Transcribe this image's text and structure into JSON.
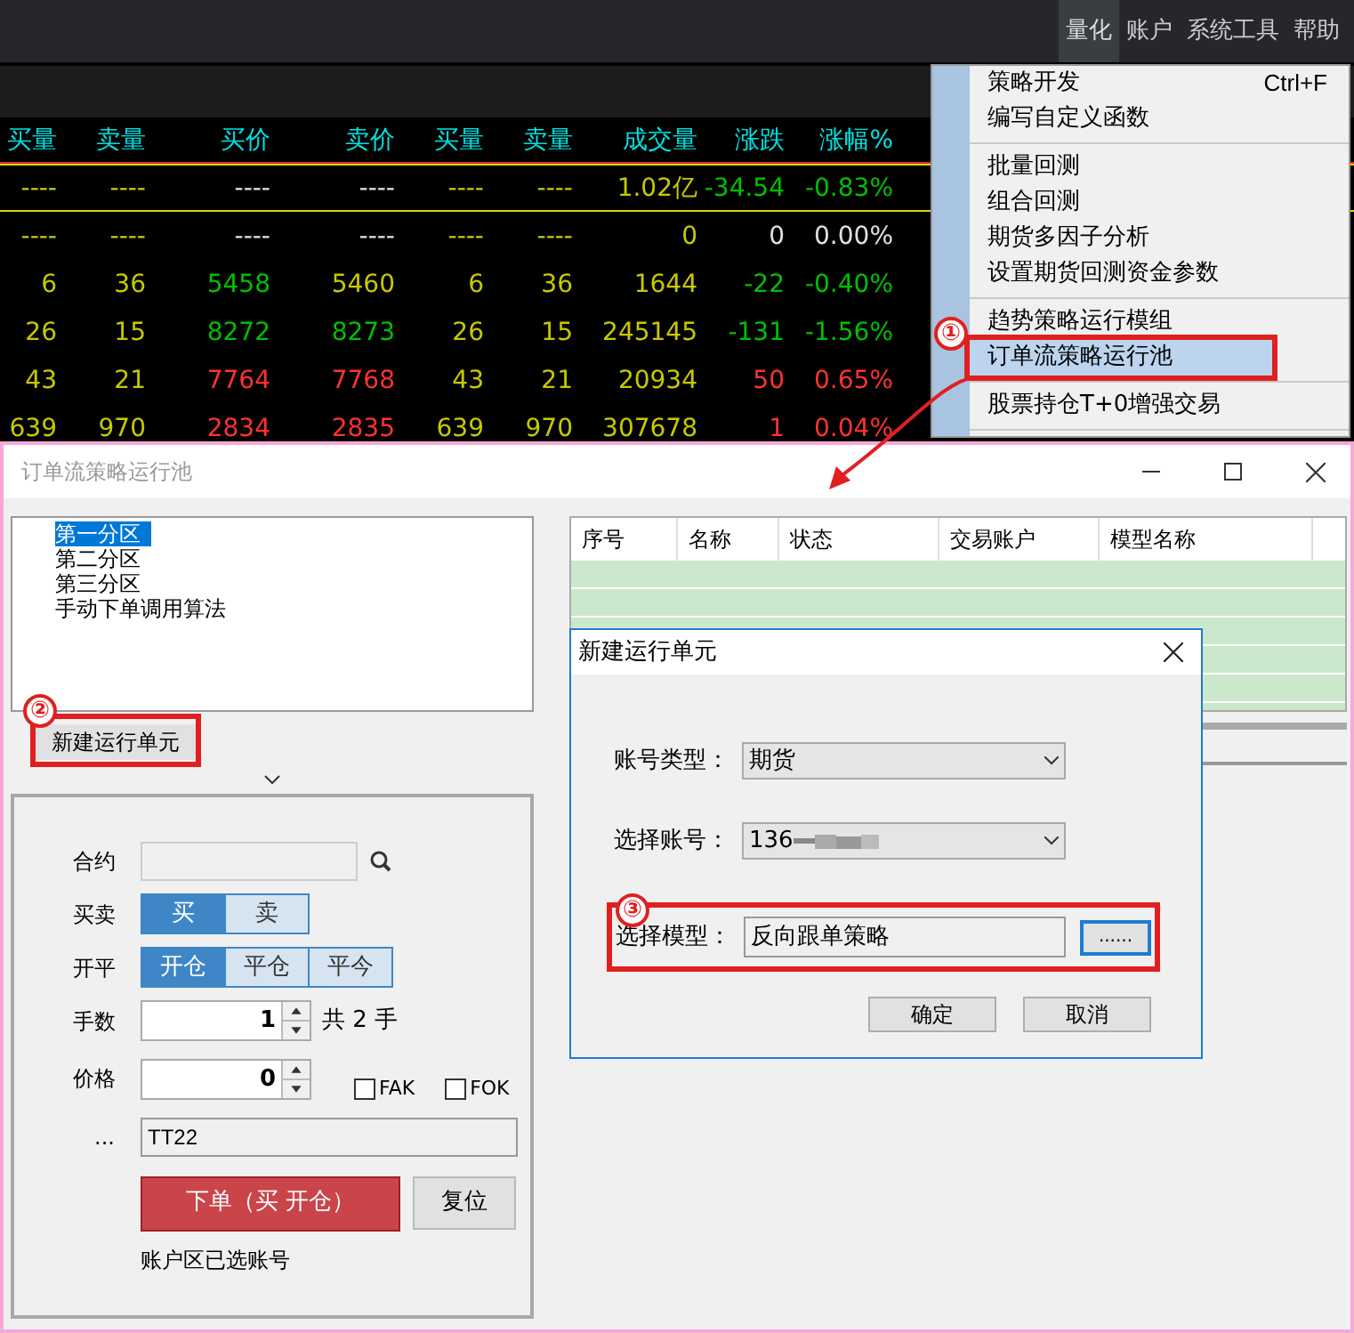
{
  "menubar": {
    "items": [
      {
        "label": "量化",
        "selected": true
      },
      {
        "label": "账户",
        "selected": false
      },
      {
        "label": "系统工具",
        "selected": false
      },
      {
        "label": "帮助",
        "selected": false
      }
    ]
  },
  "quote_table": {
    "columns": [
      "买量",
      "卖量",
      "买价",
      "卖价",
      "买量",
      "卖量",
      "成交量",
      "涨跌",
      "涨幅%"
    ],
    "rows": [
      {
        "selected": true,
        "cells": [
          {
            "text": "----",
            "color": "#c8c800"
          },
          {
            "text": "----",
            "color": "#c8c800"
          },
          {
            "text": "----",
            "color": "#e0e0e0"
          },
          {
            "text": "----",
            "color": "#e0e0e0"
          },
          {
            "text": "----",
            "color": "#c8c800"
          },
          {
            "text": "----",
            "color": "#c8c800"
          },
          {
            "text": "1.02亿",
            "color": "#c8c800"
          },
          {
            "text": "-34.54",
            "color": "#00c000"
          },
          {
            "text": "-0.83%",
            "color": "#00c000"
          }
        ]
      },
      {
        "selected": false,
        "cells": [
          {
            "text": "----",
            "color": "#c8c800"
          },
          {
            "text": "----",
            "color": "#c8c800"
          },
          {
            "text": "----",
            "color": "#e0e0e0"
          },
          {
            "text": "----",
            "color": "#e0e0e0"
          },
          {
            "text": "----",
            "color": "#c8c800"
          },
          {
            "text": "----",
            "color": "#c8c800"
          },
          {
            "text": "0",
            "color": "#c8c800"
          },
          {
            "text": "0",
            "color": "#e0e0e0"
          },
          {
            "text": "0.00%",
            "color": "#e0e0e0"
          }
        ]
      },
      {
        "selected": false,
        "cells": [
          {
            "text": "6",
            "color": "#c8c800"
          },
          {
            "text": "36",
            "color": "#c8c800"
          },
          {
            "text": "5458",
            "color": "#00c000"
          },
          {
            "text": "5460",
            "color": "#c8c800"
          },
          {
            "text": "6",
            "color": "#c8c800"
          },
          {
            "text": "36",
            "color": "#c8c800"
          },
          {
            "text": "1644",
            "color": "#c8c800"
          },
          {
            "text": "-22",
            "color": "#00c000"
          },
          {
            "text": "-0.40%",
            "color": "#00c000"
          }
        ]
      },
      {
        "selected": false,
        "cells": [
          {
            "text": "26",
            "color": "#c8c800"
          },
          {
            "text": "15",
            "color": "#c8c800"
          },
          {
            "text": "8272",
            "color": "#00c000"
          },
          {
            "text": "8273",
            "color": "#00c000"
          },
          {
            "text": "26",
            "color": "#c8c800"
          },
          {
            "text": "15",
            "color": "#c8c800"
          },
          {
            "text": "245145",
            "color": "#c8c800"
          },
          {
            "text": "-131",
            "color": "#00c000"
          },
          {
            "text": "-1.56%",
            "color": "#00c000"
          }
        ]
      },
      {
        "selected": false,
        "cells": [
          {
            "text": "43",
            "color": "#c8c800"
          },
          {
            "text": "21",
            "color": "#c8c800"
          },
          {
            "text": "7764",
            "color": "#ff3232"
          },
          {
            "text": "7768",
            "color": "#ff3232"
          },
          {
            "text": "43",
            "color": "#c8c800"
          },
          {
            "text": "21",
            "color": "#c8c800"
          },
          {
            "text": "20934",
            "color": "#c8c800"
          },
          {
            "text": "50",
            "color": "#ff3232"
          },
          {
            "text": "0.65%",
            "color": "#ff3232"
          }
        ]
      },
      {
        "selected": false,
        "cells": [
          {
            "text": "639",
            "color": "#c8c800"
          },
          {
            "text": "970",
            "color": "#c8c800"
          },
          {
            "text": "2834",
            "color": "#ff3232"
          },
          {
            "text": "2835",
            "color": "#ff3232"
          },
          {
            "text": "639",
            "color": "#c8c800"
          },
          {
            "text": "970",
            "color": "#c8c800"
          },
          {
            "text": "307678",
            "color": "#c8c800"
          },
          {
            "text": "1",
            "color": "#ff3232"
          },
          {
            "text": "0.04%",
            "color": "#ff3232"
          }
        ]
      }
    ]
  },
  "menu": {
    "items": [
      {
        "kind": "item",
        "label": "策略开发",
        "shortcut": "Ctrl+F",
        "selected": false
      },
      {
        "kind": "item",
        "label": "编写自定义函数",
        "selected": false
      },
      {
        "kind": "separator"
      },
      {
        "kind": "item",
        "label": "批量回测",
        "selected": false
      },
      {
        "kind": "item",
        "label": "组合回测",
        "selected": false
      },
      {
        "kind": "item",
        "label": "期货多因子分析",
        "selected": false
      },
      {
        "kind": "item",
        "label": "设置期货回测资金参数",
        "selected": false
      },
      {
        "kind": "separator"
      },
      {
        "kind": "item",
        "label": "趋势策略运行模组",
        "selected": false
      },
      {
        "kind": "item",
        "label": "订单流策略运行池",
        "selected": true,
        "marker": "①"
      },
      {
        "kind": "separator"
      },
      {
        "kind": "item",
        "label": "股票持仓T+0增强交易",
        "selected": false
      },
      {
        "kind": "separator"
      }
    ]
  },
  "window": {
    "title": "订单流策略运行池"
  },
  "partitions": {
    "items": [
      {
        "label": "第一分区",
        "selected": true
      },
      {
        "label": "第二分区",
        "selected": false
      },
      {
        "label": "第三分区",
        "selected": false
      },
      {
        "label": "手动下单调用算法",
        "selected": false
      }
    ]
  },
  "new_button": {
    "label": "新建运行单元",
    "marker": "②"
  },
  "order_form": {
    "contract": {
      "label": "合约"
    },
    "side": {
      "label": "买卖",
      "options": [
        {
          "label": "买",
          "selected": true
        },
        {
          "label": "卖",
          "selected": false
        }
      ]
    },
    "offset": {
      "label": "开平",
      "options": [
        {
          "label": "开仓",
          "selected": true
        },
        {
          "label": "平仓",
          "selected": false
        },
        {
          "label": "平今",
          "selected": false
        }
      ]
    },
    "lots": {
      "label": "手数",
      "value": "1",
      "total": "共 2 手"
    },
    "price": {
      "label": "价格",
      "value": "0"
    },
    "flags": [
      {
        "label": "FAK",
        "checked": false
      },
      {
        "label": "FOK",
        "checked": false
      }
    ],
    "note": {
      "label": "...",
      "value": "TT22"
    },
    "submit": "下单（买 开仓）",
    "reset": "复位",
    "status": "账户区已选账号"
  },
  "unit_table": {
    "columns": [
      "序号",
      "名称",
      "状态",
      "交易账户",
      "模型名称"
    ]
  },
  "dialog": {
    "title": "新建运行单元",
    "fields": [
      {
        "kind": "select",
        "label": "账号类型：",
        "value": "期货",
        "masked": false
      },
      {
        "kind": "select",
        "label": "选择账号：",
        "value": "136",
        "masked": true
      },
      {
        "kind": "browse",
        "label": "选择模型：",
        "value": "反向跟单策略",
        "button": "......",
        "marker": "③"
      }
    ],
    "buttons": [
      "确定",
      "取消"
    ]
  }
}
